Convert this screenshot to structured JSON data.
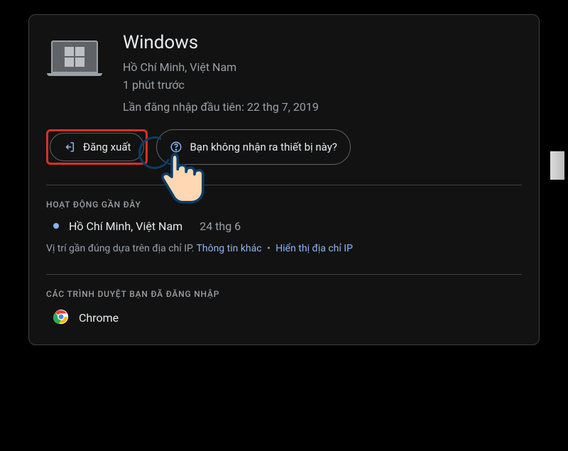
{
  "device": {
    "title": "Windows",
    "location": "Hồ Chí Minh, Việt Nam",
    "last_seen": "1 phút trước",
    "first_signin_label": "Lần đăng nhập đầu tiên:",
    "first_signin_date": "22 thg 7, 2019"
  },
  "actions": {
    "sign_out": "Đăng xuất",
    "dont_recognize": "Bạn không nhận ra thiết bị này?"
  },
  "recent": {
    "title": "HOẠT ĐỘNG GẦN ĐÂY",
    "items": [
      {
        "location": "Hồ Chí Minh, Việt Nam",
        "date": "24 thg 6"
      }
    ]
  },
  "ip_note": {
    "text": "Vị trí gần đúng dựa trên địa chỉ IP.",
    "more": "Thông tin khác",
    "show_ip": "Hiển thị địa chỉ IP"
  },
  "browsers": {
    "title": "CÁC TRÌNH DUYỆT BẠN ĐÃ ĐĂNG NHẬP",
    "items": [
      {
        "name": "Chrome"
      }
    ]
  }
}
